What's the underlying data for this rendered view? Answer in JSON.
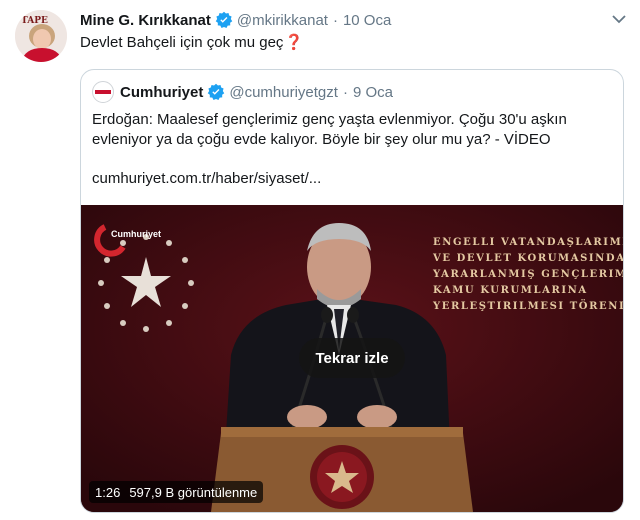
{
  "tweet": {
    "author_name": "Mine G. Kırıkkanat",
    "author_handle": "@mkirikkanat",
    "separator": "·",
    "time": "10 Oca",
    "text": "Devlet Bahçeli için çok mu geç",
    "emoji_mark": "❓",
    "avatar_tag": "TAPE"
  },
  "quoted": {
    "author_name": "Cumhuriyet",
    "author_handle": "@cumhuriyetgzt",
    "separator": "·",
    "time": "9 Oca",
    "text_line1": "Erdoğan: Maalesef gençlerimiz genç yaşta evlenmiyor. Çoğu 30'u aşkın",
    "text_line2": "evleniyor ya da çoğu evde kalıyor. Böyle bir şey olur mu ya?  - VİDEO",
    "link": "cumhuriyet.com.tr/haber/siyaset/..."
  },
  "video": {
    "logo_text": "Cumhuriyet",
    "banner_lines": [
      "Engelli Vatandaşlarımızın",
      "ve Devlet Korumasından",
      "Yararlanmış Gençlerimizin",
      "Kamu Kurumlarına",
      "Yerleştirilmesi Töreni"
    ],
    "replay_label": "Tekrar izle",
    "duration": "1:26",
    "views": "597,9 B görüntülenme"
  },
  "colors": {
    "verified": "#1da1f2",
    "text_secondary": "#657786",
    "border": "#ccd6dd",
    "video_bg": "#3a0b10",
    "brand_red": "#c8102e"
  },
  "icons": [
    "verified-badge-icon",
    "caret-down-icon",
    "red-question-mark-icon"
  ]
}
